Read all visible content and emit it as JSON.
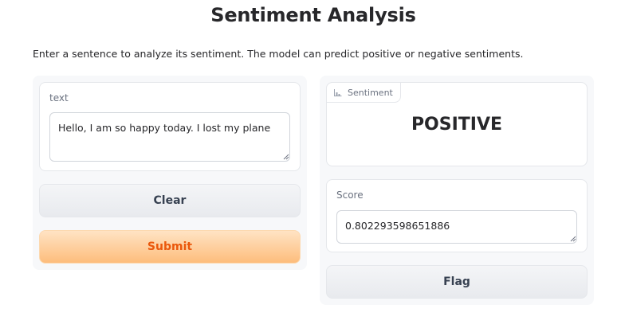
{
  "header": {
    "title": "Sentiment Analysis",
    "description": "Enter a sentence to analyze its sentiment. The model can predict positive or negative sentiments."
  },
  "input_panel": {
    "text_field": {
      "label": "text",
      "value": "Hello, I am so happy today. I lost my plane"
    },
    "clear_label": "Clear",
    "submit_label": "Submit"
  },
  "output_panel": {
    "sentiment": {
      "label": "Sentiment",
      "icon": "bar-chart-icon",
      "value": "POSITIVE"
    },
    "score": {
      "label": "Score",
      "value": "0.802293598651886"
    },
    "flag_label": "Flag"
  },
  "colors": {
    "primary_button_text": "#ea580c",
    "primary_button_gradient": [
      "#ffe3c4",
      "#fdbd7c"
    ],
    "panel_background": "#f7f8fa"
  }
}
